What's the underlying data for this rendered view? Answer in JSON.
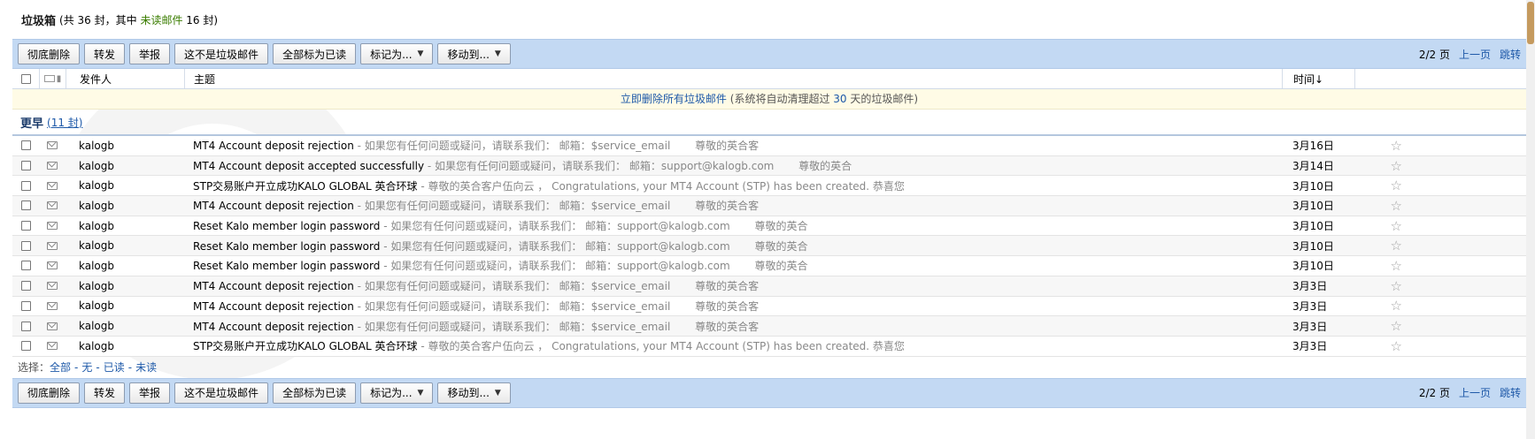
{
  "header": {
    "folder_name": "垃圾箱",
    "stat_prefix": "(共 36 封，其中",
    "unread_label": "未读邮件",
    "stat_suffix": "16 封)"
  },
  "toolbar": {
    "delete_label": "彻底删除",
    "forward_label": "转发",
    "report_label": "举报",
    "not_spam_label": "这不是垃圾邮件",
    "mark_all_read_label": "全部标为已读",
    "mark_as_label": "标记为...",
    "move_to_label": "移动到...",
    "page_info": "2/2 页",
    "prev_page_label": "上一页",
    "jump_label": "跳转"
  },
  "columns": {
    "sender": "发件人",
    "subject": "主题",
    "time": "时间↓"
  },
  "notice": {
    "text_before": "立即删除所有垃圾邮件",
    "text_mid": "(系统将自动清理超过",
    "days": "30",
    "text_after": "天的垃圾邮件)"
  },
  "group": {
    "name": "更早",
    "count": "(11 封)"
  },
  "emails": [
    {
      "sender": "kalogb",
      "subject": "MT4 Account deposit rejection",
      "abstract": " - 如果您有任何问题或疑问，请联系我们： 邮箱：$service_email 　　尊敬的英合客",
      "date": "3月16日"
    },
    {
      "sender": "kalogb",
      "subject": "MT4 Account deposit accepted successfully",
      "abstract": " - 如果您有任何问题或疑问，请联系我们： 邮箱：support@kalogb.com 　　尊敬的英合",
      "date": "3月14日"
    },
    {
      "sender": "kalogb",
      "subject": "STP交易账户开立成功KALO GLOBAL 英合环球",
      "abstract": " - 尊敬的英合客户伍向云 ， Congratulations, your MT4 Account (STP) has been created. 恭喜您",
      "date": "3月10日"
    },
    {
      "sender": "kalogb",
      "subject": "MT4 Account deposit rejection",
      "abstract": " - 如果您有任何问题或疑问，请联系我们： 邮箱：$service_email 　　尊敬的英合客",
      "date": "3月10日"
    },
    {
      "sender": "kalogb",
      "subject": "Reset Kalo member login password",
      "abstract": " - 如果您有任何问题或疑问，请联系我们： 邮箱：support@kalogb.com 　　尊敬的英合",
      "date": "3月10日"
    },
    {
      "sender": "kalogb",
      "subject": "Reset Kalo member login password",
      "abstract": " - 如果您有任何问题或疑问，请联系我们： 邮箱：support@kalogb.com 　　尊敬的英合",
      "date": "3月10日"
    },
    {
      "sender": "kalogb",
      "subject": "Reset Kalo member login password",
      "abstract": " - 如果您有任何问题或疑问，请联系我们： 邮箱：support@kalogb.com 　　尊敬的英合",
      "date": "3月10日"
    },
    {
      "sender": "kalogb",
      "subject": "MT4 Account deposit rejection",
      "abstract": " - 如果您有任何问题或疑问，请联系我们： 邮箱：$service_email 　　尊敬的英合客",
      "date": "3月3日"
    },
    {
      "sender": "kalogb",
      "subject": "MT4 Account deposit rejection",
      "abstract": " - 如果您有任何问题或疑问，请联系我们： 邮箱：$service_email 　　尊敬的英合客",
      "date": "3月3日"
    },
    {
      "sender": "kalogb",
      "subject": "MT4 Account deposit rejection",
      "abstract": " - 如果您有任何问题或疑问，请联系我们： 邮箱：$service_email 　　尊敬的英合客",
      "date": "3月3日"
    },
    {
      "sender": "kalogb",
      "subject": "STP交易账户开立成功KALO GLOBAL 英合环球",
      "abstract": " - 尊敬的英合客户伍向云 ， Congratulations, your MT4 Account (STP) has been created. 恭喜您",
      "date": "3月3日"
    }
  ],
  "selection": {
    "label": "选择：",
    "all": "全部",
    "none": "无",
    "read": "已读",
    "unread": "未读",
    "sep": "-"
  },
  "icons": {
    "star": "☆",
    "clip": "📎"
  },
  "colors": {
    "toolbar_bg": "#c3d9f3",
    "link": "#1d58a8",
    "unread_green": "#3a7d00",
    "notice_bg": "#fffbe6"
  }
}
